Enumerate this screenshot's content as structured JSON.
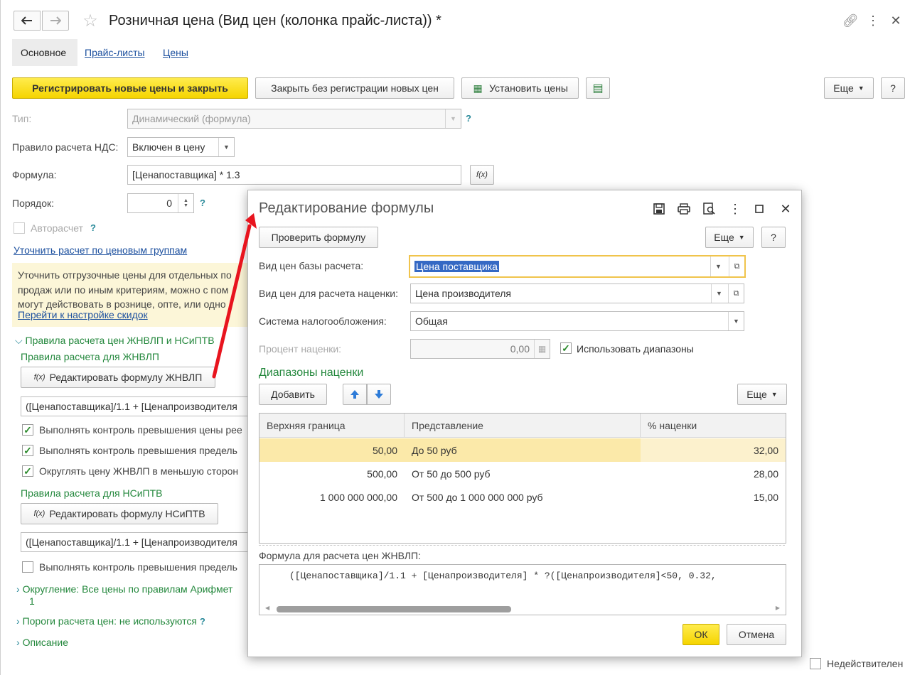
{
  "window": {
    "title": "Розничная цена (Вид цен (колонка прайс-листа)) *",
    "tabs": [
      "Основное",
      "Прайс-листы",
      "Цены"
    ]
  },
  "toolbar": {
    "register_close": "Регистрировать новые цены и закрыть",
    "close_no_register": "Закрыть без регистрации новых цен",
    "set_prices": "Установить цены",
    "more": "Еще",
    "help": "?"
  },
  "form": {
    "type_label": "Тип:",
    "type_value": "Динамический (формула)",
    "vat_label": "Правило расчета НДС:",
    "vat_value": "Включен в цену",
    "formula_label": "Формула:",
    "formula_value": "[Ценапоставщика] * 1.3",
    "order_label": "Порядок:",
    "order_value": "0",
    "autocalc_label": "Авторасчет",
    "refine_link": "Уточнить расчет по ценовым группам",
    "info_line1": "Уточнить отгрузочные цены для отдельных по",
    "info_line2": "продаж или по иным критериям, можно с пом",
    "info_line3": "могут действовать в рознице, опте, или одно",
    "info_link": "Перейти к настройке скидок",
    "rules_group": "Правила расчета цен ЖНВЛП и НСиПТВ",
    "rules_zhnvlp": "Правила расчета для ЖНВЛП",
    "edit_zhnvlp": "Редактировать формулу ЖНВЛП",
    "zhnvlp_formula": "([Ценапоставщика]/1.1 + [Ценапроизводителя",
    "check1": "Выполнять контроль превышения цены рее",
    "check2": "Выполнять контроль превышения предель",
    "check3": "Округлять цену ЖНВЛП в меньшую сторон",
    "rules_nsiptv": "Правила расчета для НСиПТВ",
    "edit_nsiptv": "Редактировать формулу НСиПТВ",
    "nsiptv_formula": "([Ценапоставщика]/1.1 + [Ценапроизводителя",
    "check4": "Выполнять контроль превышения предель",
    "rounding": "Округление: Все цены по правилам Арифмет",
    "rounding2": "1",
    "thresholds": "Пороги расчета цен: не используются",
    "description": "Описание",
    "inactive": "Недействителен"
  },
  "dialog": {
    "title": "Редактирование формулы",
    "check_formula": "Проверить формулу",
    "more": "Еще",
    "help": "?",
    "base_label": "Вид цен базы расчета:",
    "base_value": "Цена поставщика",
    "markup_type_label": "Вид цен для расчета наценки:",
    "markup_type_value": "Цена производителя",
    "tax_label": "Система налогообложения:",
    "tax_value": "Общая",
    "percent_label": "Процент наценки:",
    "percent_value": "0,00",
    "use_ranges": "Использовать диапазоны",
    "ranges_title": "Диапазоны наценки",
    "add": "Добавить",
    "table_more": "Еще",
    "columns": [
      "Верхняя граница",
      "Представление",
      "% наценки"
    ],
    "rows": [
      {
        "upper": "50,00",
        "repr": "До 50 руб",
        "pct": "32,00"
      },
      {
        "upper": "500,00",
        "repr": "От 50 до 500 руб",
        "pct": "28,00"
      },
      {
        "upper": "1 000 000 000,00",
        "repr": "От 500 до 1 000 000 000 руб",
        "pct": "15,00"
      }
    ],
    "formula_caption": "Формула для расчета цен ЖНВЛП:",
    "formula_text": "([Ценапоставщика]/1.1 + [Ценапроизводителя] * ?([Ценапроизводителя]<50, 0.32,",
    "ok": "ОК",
    "cancel": "Отмена"
  }
}
